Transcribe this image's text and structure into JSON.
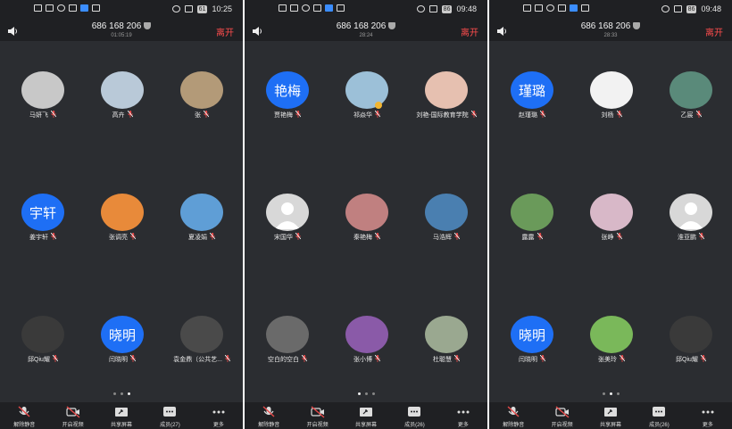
{
  "panels": [
    {
      "status": {
        "time": "10:25",
        "battery": "61"
      },
      "meeting_number": "686 168 206",
      "timer": "01:05:19",
      "leave_label": "离开",
      "participants": [
        {
          "name": "马妍飞",
          "avatar": "photo",
          "color": "#c8c8c8"
        },
        {
          "name": "高卉",
          "avatar": "photo",
          "color": "#b9c9d8"
        },
        {
          "name": "张",
          "avatar": "photo",
          "color": "#b39a78"
        },
        {
          "name": "姜宇轩",
          "avatar": "text",
          "avatar_text": "宇轩"
        },
        {
          "name": "张调亮",
          "avatar": "photo",
          "color": "#e88a3a"
        },
        {
          "name": "夏凌娟",
          "avatar": "photo",
          "color": "#5f9ed6"
        },
        {
          "name": "邱Qiu耀",
          "avatar": "photo",
          "color": "#3a3a3a"
        },
        {
          "name": "闫晓明",
          "avatar": "text",
          "avatar_text": "晓明"
        },
        {
          "name": "袁金鼎（公共艺...",
          "avatar": "photo",
          "color": "#4a4a4a"
        }
      ],
      "page_dots": 3,
      "active_dot": 2,
      "toolbar": [
        "解除静音",
        "开启视频",
        "共享屏幕",
        "成员(27)",
        "更多"
      ]
    },
    {
      "status": {
        "time": "09:48",
        "battery": "86"
      },
      "meeting_number": "686 168 206",
      "timer": "28:24",
      "leave_label": "离开",
      "participants": [
        {
          "name": "贾艳梅",
          "avatar": "text",
          "avatar_text": "艳梅"
        },
        {
          "name": "祁焱华",
          "avatar": "photo",
          "color": "#9cc0d8",
          "host": true
        },
        {
          "name": "刘艳-国际教育学院",
          "avatar": "photo",
          "color": "#e6c0b0"
        },
        {
          "name": "宋国华",
          "avatar": "default"
        },
        {
          "name": "秦艳梅",
          "avatar": "photo",
          "color": "#c08080"
        },
        {
          "name": "马浩辉",
          "avatar": "photo",
          "color": "#4a7fb0"
        },
        {
          "name": "空白的空白",
          "avatar": "photo",
          "color": "#6a6a6a"
        },
        {
          "name": "张小博",
          "avatar": "photo",
          "color": "#8a5aa8"
        },
        {
          "name": "杜聪慧",
          "avatar": "photo",
          "color": "#9aa890"
        }
      ],
      "page_dots": 3,
      "active_dot": 0,
      "toolbar": [
        "解除静音",
        "开启视频",
        "共享屏幕",
        "成员(26)",
        "更多"
      ]
    },
    {
      "status": {
        "time": "09:48",
        "battery": "86"
      },
      "meeting_number": "686 168 206",
      "timer": "28:33",
      "leave_label": "离开",
      "participants": [
        {
          "name": "赵瑾璐",
          "avatar": "text",
          "avatar_text": "瑾璐"
        },
        {
          "name": "刘杨",
          "avatar": "photo",
          "color": "#f2f2f2"
        },
        {
          "name": "乙宸",
          "avatar": "photo",
          "color": "#5a8a7a"
        },
        {
          "name": "露露",
          "avatar": "photo",
          "color": "#6a9a5a"
        },
        {
          "name": "张峥",
          "avatar": "photo",
          "color": "#d8b8c8"
        },
        {
          "name": "淮亚鹏",
          "avatar": "default"
        },
        {
          "name": "闫晓明",
          "avatar": "text",
          "avatar_text": "晓明"
        },
        {
          "name": "张美玲",
          "avatar": "photo",
          "color": "#7ab85a"
        },
        {
          "name": "邱Qiu耀",
          "avatar": "photo",
          "color": "#3a3a3a"
        }
      ],
      "page_dots": 3,
      "active_dot": 1,
      "toolbar": [
        "解除静音",
        "开启视频",
        "共享屏幕",
        "成员(26)",
        "更多"
      ]
    }
  ]
}
